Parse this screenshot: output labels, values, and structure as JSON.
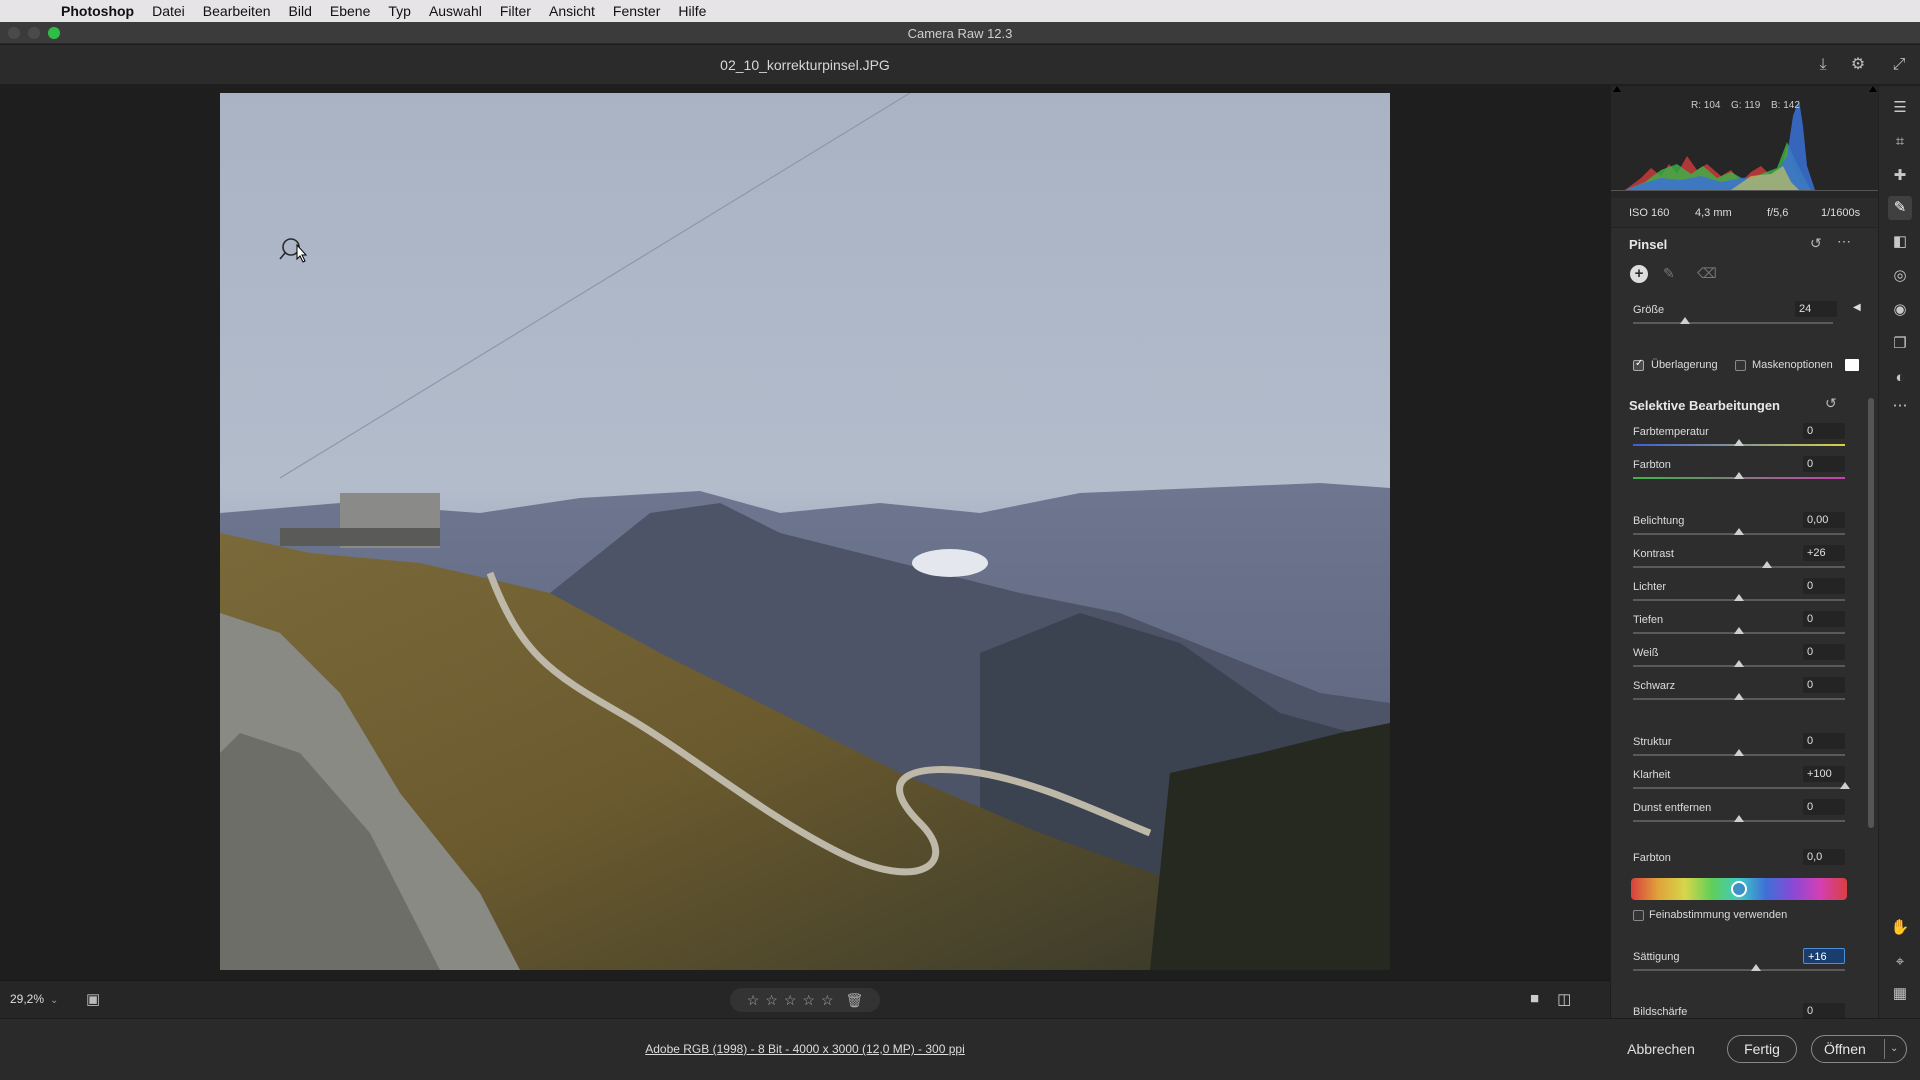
{
  "menubar": {
    "items": [
      "Photoshop",
      "Datei",
      "Bearbeiten",
      "Bild",
      "Ebene",
      "Typ",
      "Auswahl",
      "Filter",
      "Ansicht",
      "Fenster",
      "Hilfe"
    ]
  },
  "window": {
    "title": "Camera Raw 12.3",
    "filename": "02_10_korrekturpinsel.JPG"
  },
  "histogram": {
    "r_label": "R:",
    "r_value": "104",
    "g_label": "G:",
    "g_value": "119",
    "b_label": "B:",
    "b_value": "142"
  },
  "camera": {
    "iso": "ISO 160",
    "focal": "4,3 mm",
    "aperture": "f/5,6",
    "shutter": "1/1600s"
  },
  "brush": {
    "title": "Pinsel",
    "size_label": "Größe",
    "size_value": "24",
    "size_fraction": 0.26,
    "overlay_label": "Überlagerung",
    "overlay_checked": true,
    "mask_label": "Maskenoptionen",
    "mask_checked": false
  },
  "selective": {
    "title": "Selektive Bearbeitungen",
    "sliders": [
      {
        "label": "Farbtemperatur",
        "value": "0",
        "fraction": 0.5
      },
      {
        "label": "Farbton",
        "value": "0",
        "fraction": 0.5
      },
      {
        "label": "Belichtung",
        "value": "0,00",
        "fraction": 0.5
      },
      {
        "label": "Kontrast",
        "value": "+26",
        "fraction": 0.63
      },
      {
        "label": "Lichter",
        "value": "0",
        "fraction": 0.5
      },
      {
        "label": "Tiefen",
        "value": "0",
        "fraction": 0.5
      },
      {
        "label": "Weiß",
        "value": "0",
        "fraction": 0.5
      },
      {
        "label": "Schwarz",
        "value": "0",
        "fraction": 0.5
      },
      {
        "label": "Struktur",
        "value": "0",
        "fraction": 0.5
      },
      {
        "label": "Klarheit",
        "value": "+100",
        "fraction": 1.0
      },
      {
        "label": "Dunst entfernen",
        "value": "0",
        "fraction": 0.5
      }
    ],
    "hue_label": "Farbton",
    "hue_value": "0,0",
    "fine_tune_label": "Feinabstimmung verwenden",
    "saturation_label": "Sättigung",
    "saturation_value": "+16",
    "saturation_fraction": 0.58,
    "sharpness_label": "Bildschärfe",
    "sharpness_value": "0"
  },
  "status": {
    "zoom": "29,2%",
    "workflow": "Adobe RGB (1998) - 8 Bit - 4000 x 3000 (12,0 MP) - 300 ppi"
  },
  "buttons": {
    "cancel": "Abbrechen",
    "done": "Fertig",
    "open": "Öffnen"
  },
  "colors": {
    "accent": "#4a90d9",
    "panel_bg": "#2d2d2d",
    "canvas_bg": "#1e1e1e"
  }
}
